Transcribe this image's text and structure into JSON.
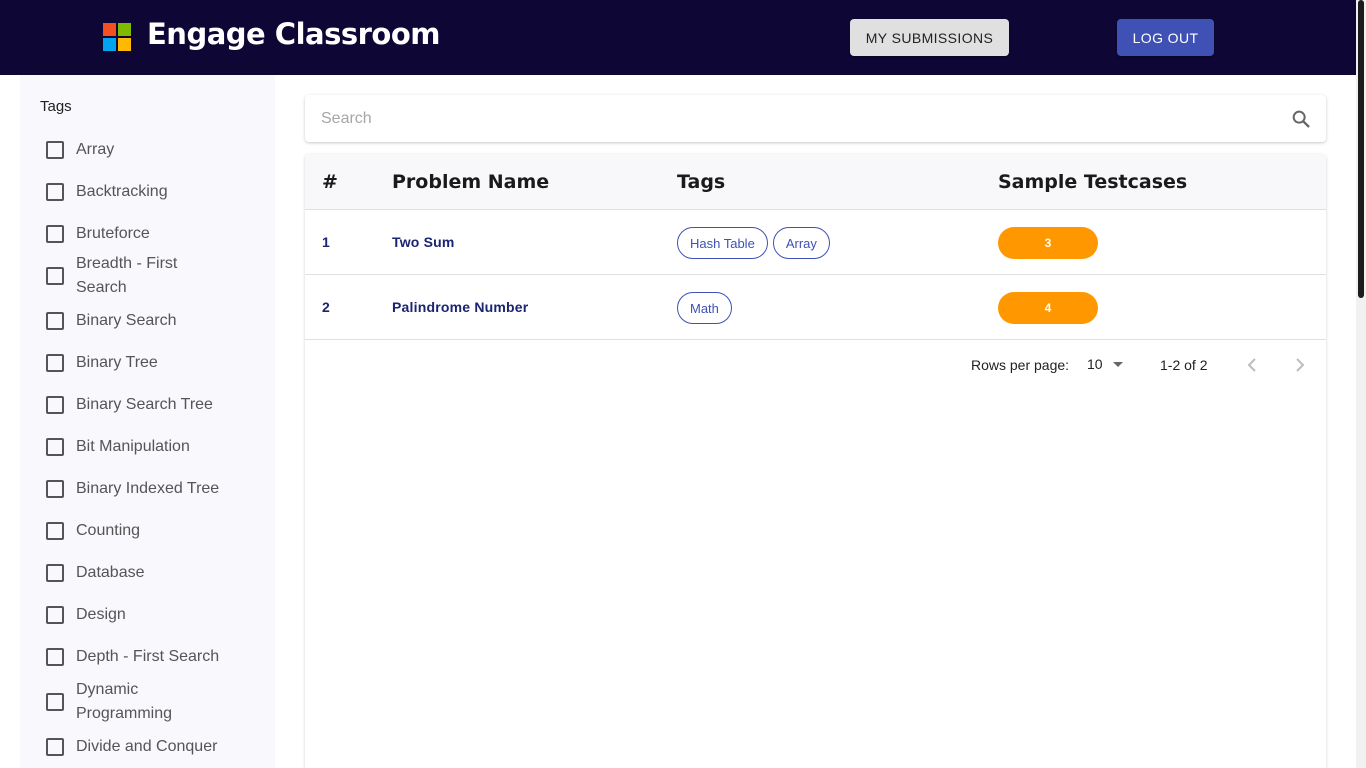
{
  "header": {
    "app_title": "Engage Classroom",
    "my_submissions_label": "MY SUBMISSIONS",
    "logout_label": "LOG OUT",
    "colors": {
      "bar": "#0e0736",
      "logout": "#3f51b5"
    }
  },
  "sidebar": {
    "title": "Tags",
    "tags": [
      {
        "label": "Array"
      },
      {
        "label": "Backtracking"
      },
      {
        "label": "Bruteforce"
      },
      {
        "label": "Breadth - First Search"
      },
      {
        "label": "Binary Search"
      },
      {
        "label": "Binary Tree"
      },
      {
        "label": "Binary Search Tree"
      },
      {
        "label": "Bit Manipulation"
      },
      {
        "label": "Binary Indexed Tree"
      },
      {
        "label": "Counting"
      },
      {
        "label": "Database"
      },
      {
        "label": "Design"
      },
      {
        "label": "Depth - First Search"
      },
      {
        "label": "Dynamic Programming"
      },
      {
        "label": "Divide and Conquer"
      }
    ]
  },
  "search": {
    "placeholder": "Search",
    "icon": "search-icon"
  },
  "table": {
    "headers": {
      "num": "#",
      "name": "Problem Name",
      "tags": "Tags",
      "testcases": "Sample Testcases"
    },
    "rows": [
      {
        "num": "1",
        "name": "Two Sum",
        "tags": [
          "Hash Table",
          "Array"
        ],
        "testcases": "3"
      },
      {
        "num": "2",
        "name": "Palindrome Number",
        "tags": [
          "Math"
        ],
        "testcases": "4"
      }
    ],
    "badge_color": "#ff9800"
  },
  "pagination": {
    "rows_per_page_label": "Rows per page:",
    "rows_per_page_value": "10",
    "range": "1-2 of 2"
  }
}
